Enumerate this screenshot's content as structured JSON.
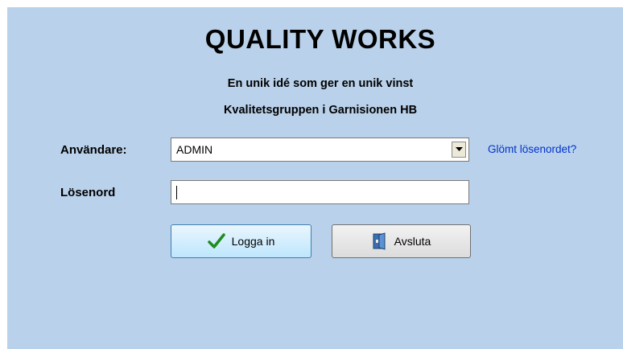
{
  "header": {
    "title": "QUALITY WORKS",
    "tagline": "En unik idé som ger en unik vinst",
    "company": "Kvalitetsgruppen i Garnisionen HB"
  },
  "form": {
    "user_label": "Användare:",
    "user_value": "ADMIN",
    "password_label": "Lösenord",
    "password_value": "",
    "forgot_link": "Glömt lösenordet?"
  },
  "buttons": {
    "login_label": "Logga in",
    "exit_label": "Avsluta"
  },
  "colors": {
    "background": "#b9d1ea",
    "link": "#0033cc"
  }
}
